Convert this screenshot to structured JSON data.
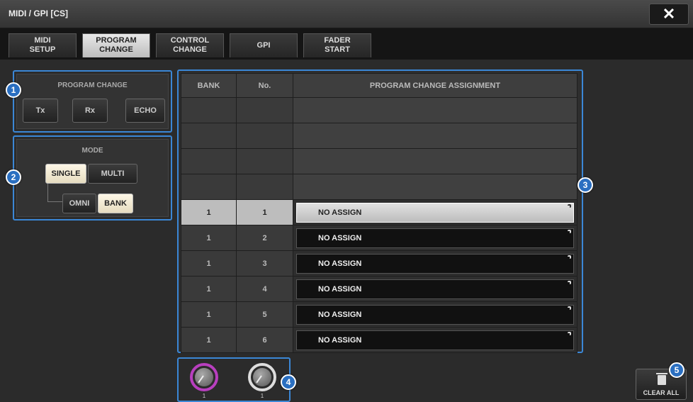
{
  "window": {
    "title": "MIDI / GPI [CS]",
    "close_symbol": "✕"
  },
  "tabs": [
    {
      "label": "MIDI\nSETUP",
      "active": false
    },
    {
      "label": "PROGRAM\nCHANGE",
      "active": true
    },
    {
      "label": "CONTROL\nCHANGE",
      "active": false
    },
    {
      "label": "GPI",
      "active": false
    },
    {
      "label": "FADER\nSTART",
      "active": false
    }
  ],
  "program_change_panel": {
    "label": "PROGRAM CHANGE",
    "tx": "Tx",
    "rx": "Rx",
    "echo": "ECHO"
  },
  "mode_panel": {
    "label": "MODE",
    "single": "SINGLE",
    "multi": "MULTI",
    "omni": "OMNI",
    "bank": "BANK",
    "single_on": true,
    "bank_on": true
  },
  "table": {
    "headers": {
      "bank": "BANK",
      "no": "No.",
      "assign": "PROGRAM CHANGE ASSIGNMENT"
    },
    "rows": [
      {
        "bank": "1",
        "no": "1",
        "assign": "NO ASSIGN",
        "selected": true
      },
      {
        "bank": "1",
        "no": "2",
        "assign": "NO ASSIGN",
        "selected": false
      },
      {
        "bank": "1",
        "no": "3",
        "assign": "NO ASSIGN",
        "selected": false
      },
      {
        "bank": "1",
        "no": "4",
        "assign": "NO ASSIGN",
        "selected": false
      },
      {
        "bank": "1",
        "no": "5",
        "assign": "NO ASSIGN",
        "selected": false
      },
      {
        "bank": "1",
        "no": "6",
        "assign": "NO ASSIGN",
        "selected": false
      }
    ]
  },
  "knobs": [
    {
      "value": "1",
      "color": "#b83fbf"
    },
    {
      "value": "1",
      "color": "#dddddd"
    }
  ],
  "clear_all": {
    "label": "CLEAR ALL",
    "icon": "trash-icon"
  },
  "badges": [
    "1",
    "2",
    "3",
    "4",
    "5"
  ],
  "colors": {
    "accent": "#3b87d6",
    "badge": "#2a6fc1"
  }
}
